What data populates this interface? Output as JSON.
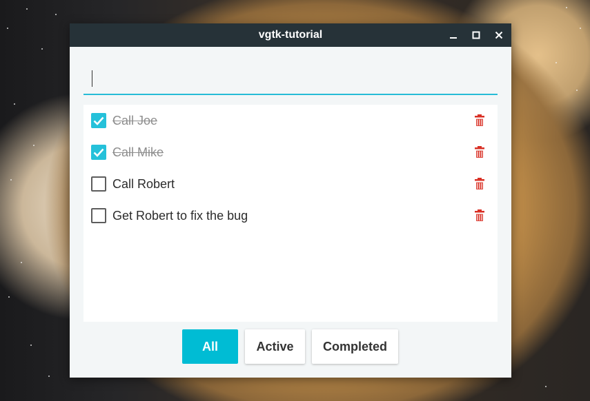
{
  "window": {
    "title": "vgtk-tutorial"
  },
  "entry": {
    "value": "",
    "placeholder": ""
  },
  "todos": [
    {
      "label": "Call Joe",
      "done": true
    },
    {
      "label": "Call Mike",
      "done": true
    },
    {
      "label": "Call Robert",
      "done": false
    },
    {
      "label": "Get Robert to fix the bug",
      "done": false
    }
  ],
  "filters": {
    "all": "All",
    "active": "Active",
    "completed": "Completed",
    "selected": "All"
  },
  "icons": {
    "delete": "trash-icon",
    "checked": "check-icon",
    "minimize": "minimize-icon",
    "maximize": "maximize-icon",
    "close": "close-icon"
  },
  "colors": {
    "accent": "#00bcd4",
    "titlebar": "#263238",
    "delete": "#d93025",
    "done_text": "#8d8d8d"
  }
}
